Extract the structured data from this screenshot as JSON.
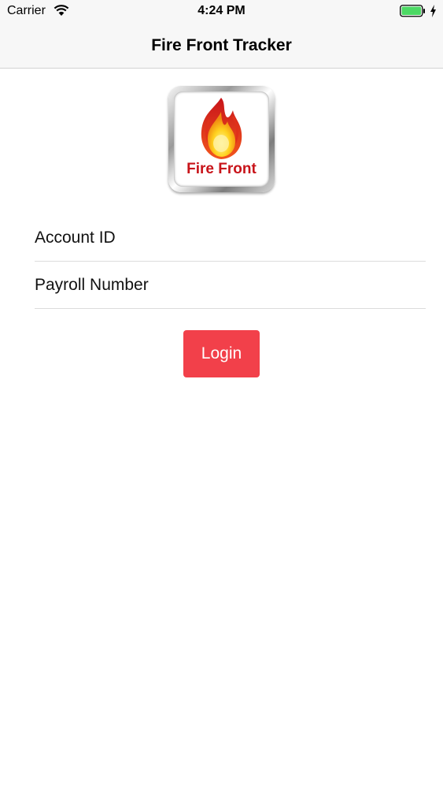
{
  "status_bar": {
    "carrier": "Carrier",
    "time": "4:24 PM",
    "icons": [
      "wifi-icon",
      "battery-icon",
      "charging-bolt-icon"
    ],
    "battery_color": "#4cd964"
  },
  "nav_bar": {
    "title": "Fire Front Tracker"
  },
  "logo": {
    "text": "Fire Front",
    "icon": "flame-icon",
    "text_color": "#c8141a"
  },
  "form": {
    "account_id": {
      "placeholder": "Account ID",
      "value": ""
    },
    "payroll_number": {
      "placeholder": "Payroll Number",
      "value": ""
    },
    "login_label": "Login"
  },
  "colors": {
    "accent": "#f2404a",
    "bar_background": "#f7f7f7"
  }
}
